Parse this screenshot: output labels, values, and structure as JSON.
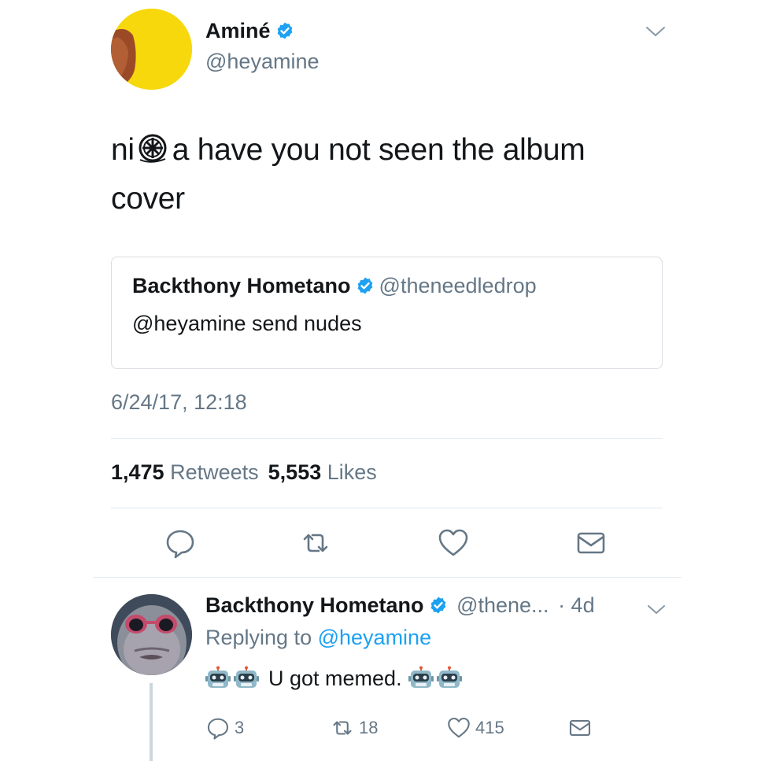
{
  "main_tweet": {
    "author_name": "Aminé",
    "author_handle": "@heyamine",
    "text_before": "ni",
    "text_after": "a have you not seen the album",
    "text_line2": "cover",
    "timestamp": "6/24/17, 12:18"
  },
  "quoted_tweet": {
    "author_name": "Backthony Hometano",
    "author_handle": "@theneedledrop",
    "text": "@heyamine send nudes"
  },
  "stats": {
    "retweets_count": "1,475",
    "retweets_label": "Retweets",
    "likes_count": "5,553",
    "likes_label": "Likes"
  },
  "actions": [
    "reply-icon",
    "retweet-icon",
    "heart-icon",
    "envelope-icon"
  ],
  "reply": {
    "author_name": "Backthony Hometano",
    "author_handle": "@thene...",
    "age": "· 4d",
    "replying_prefix": "Replying to",
    "replying_mention": "@heyamine",
    "text": "U got memed.",
    "reply_count": "3",
    "retweet_count": "18",
    "like_count": "415"
  },
  "colors": {
    "verified": "#1da1f2",
    "secondary_text": "#657786",
    "link": "#1da1f2",
    "divider": "#e1e8ed"
  }
}
